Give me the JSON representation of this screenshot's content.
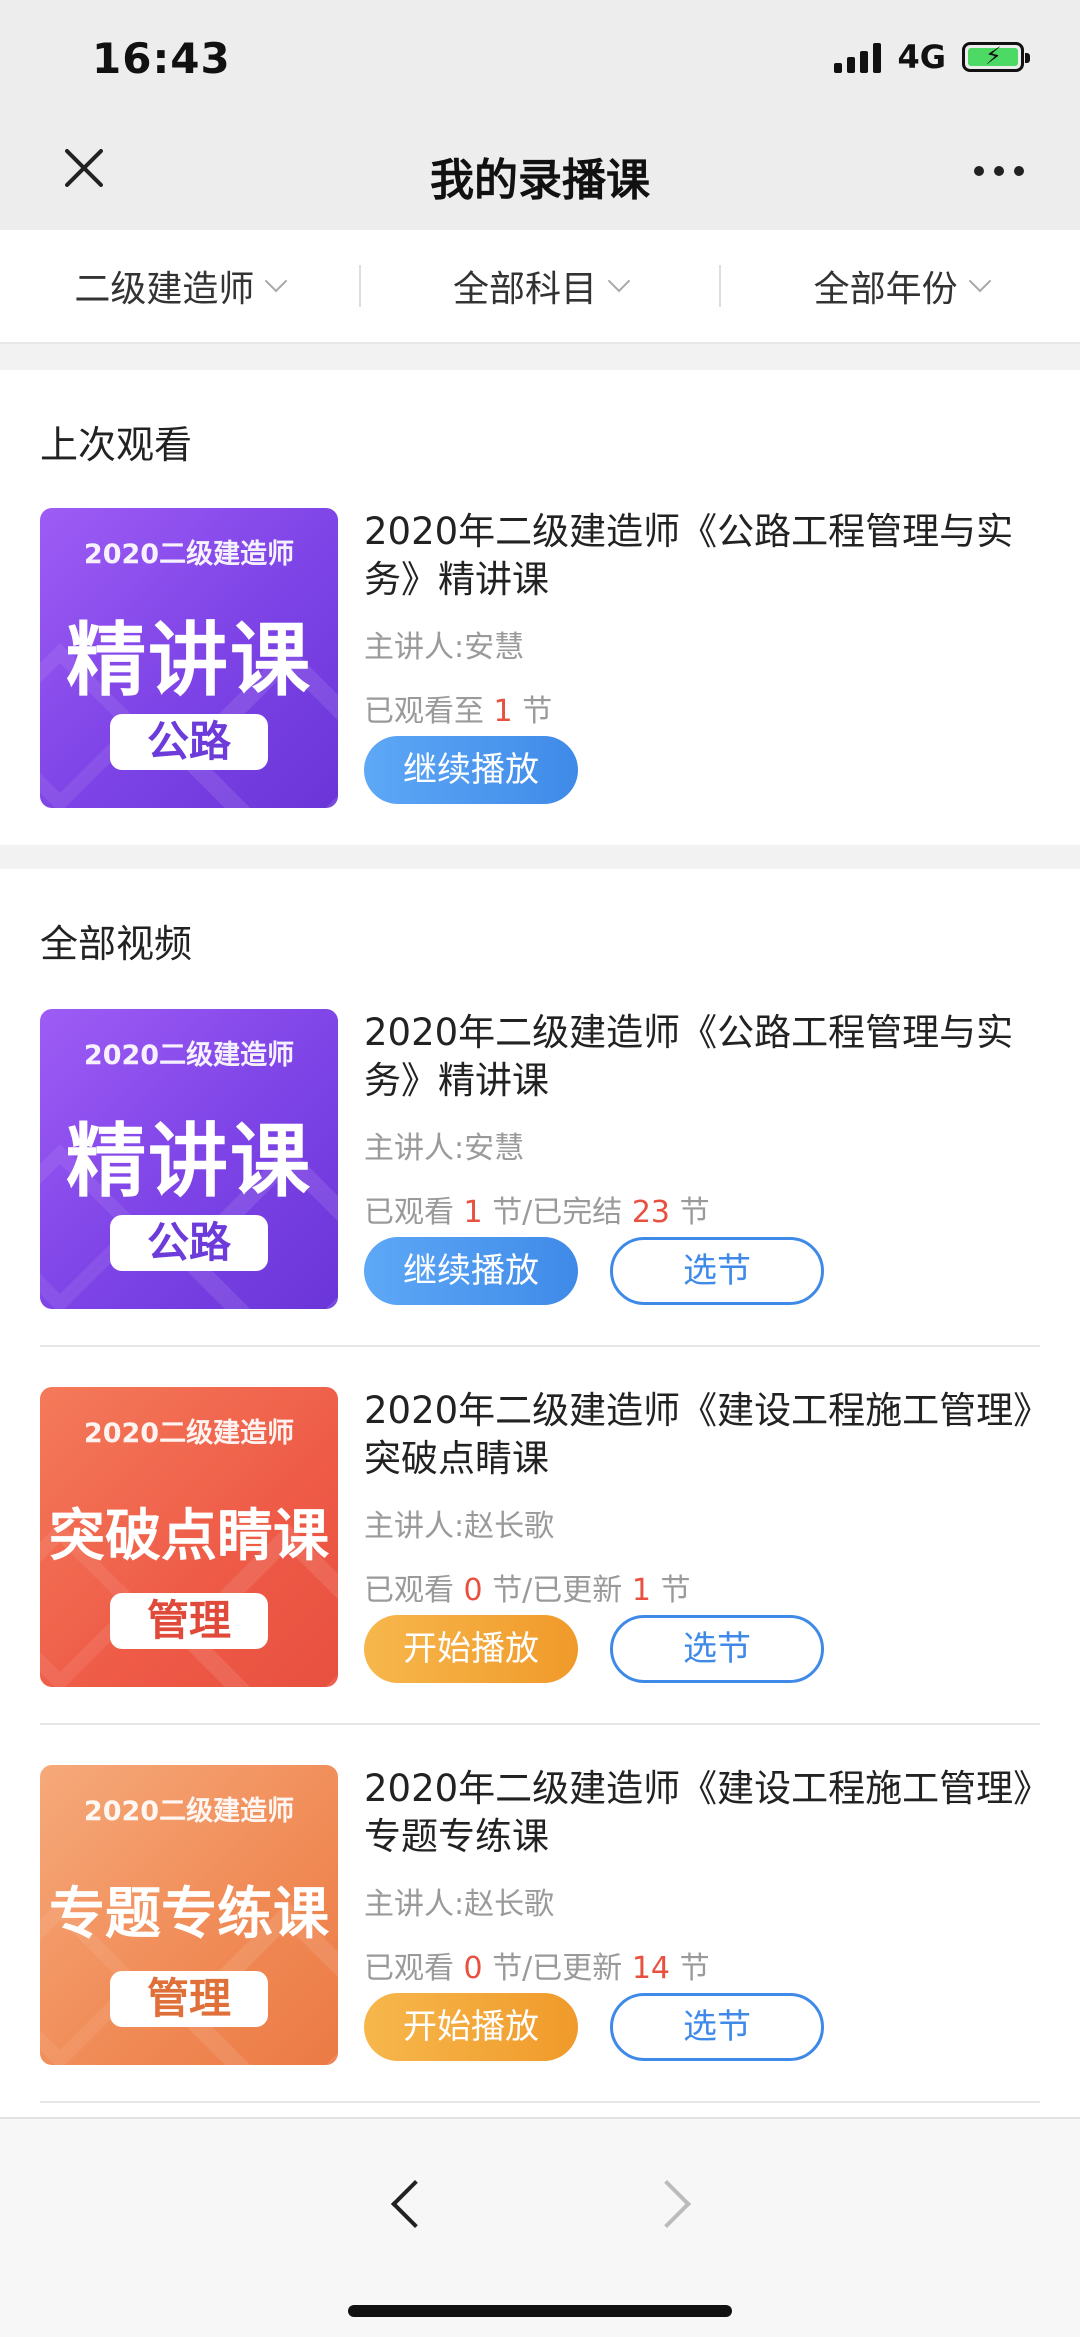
{
  "status_bar": {
    "time": "16:43",
    "network": "4G"
  },
  "nav": {
    "title": "我的录播课"
  },
  "filters": [
    {
      "label": "二级建造师"
    },
    {
      "label": "全部科目"
    },
    {
      "label": "全部年份"
    }
  ],
  "last_watched": {
    "section_title": "上次观看",
    "course": {
      "thumb_top": "2020二级建造师",
      "thumb_main": "精讲课",
      "thumb_tag": "公路",
      "title": "2020年二级建造师《公路工程管理与实务》精讲课",
      "teacher": "主讲人:安慧",
      "progress_prefix": "已观看至",
      "watched": "1",
      "progress_suffix": "节",
      "play_label": "继续播放"
    }
  },
  "all_videos": {
    "section_title": "全部视频",
    "courses": [
      {
        "thumb_top": "2020二级建造师",
        "thumb_main": "精讲课",
        "thumb_tag": "公路",
        "title": "2020年二级建造师《公路工程管理与实务》精讲课",
        "teacher": "主讲人:安慧",
        "p1": "已观看",
        "watched": "1",
        "p2": "节/已完结",
        "total": "23",
        "p3": "节",
        "play_label": "继续播放",
        "select_label": "选节"
      },
      {
        "thumb_top": "2020二级建造师",
        "thumb_main": "突破点睛课",
        "thumb_tag": "管理",
        "title": "2020年二级建造师《建设工程施工管理》突破点睛课",
        "teacher": "主讲人:赵长歌",
        "p1": "已观看",
        "watched": "0",
        "p2": "节/已更新",
        "total": "1",
        "p3": "节",
        "play_label": "开始播放",
        "select_label": "选节"
      },
      {
        "thumb_top": "2020二级建造师",
        "thumb_main": "专题专练课",
        "thumb_tag": "管理",
        "title": "2020年二级建造师《建设工程施工管理》专题专练课",
        "teacher": "主讲人:赵长歌",
        "p1": "已观看",
        "watched": "0",
        "p2": "节/已更新",
        "total": "14",
        "p3": "节",
        "play_label": "开始播放",
        "select_label": "选节"
      }
    ]
  }
}
